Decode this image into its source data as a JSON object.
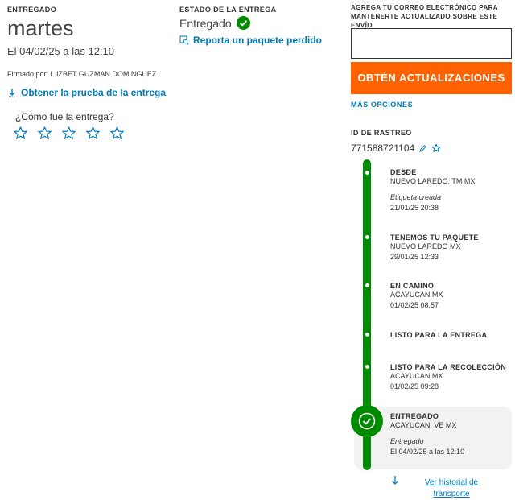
{
  "delivery": {
    "label": "ENTREGADO",
    "day": "martes",
    "date_line": "El 04/02/25 a las 12:10",
    "signed_by": "Firmado por: L.IZBET GUZMAN DOMINGUEZ",
    "proof_link": "Obtener la prueba de la entrega",
    "rating_question": "¿Cómo fue la entrega?",
    "rating_stars": 5
  },
  "status": {
    "label": "ESTADO DE LA ENTREGA",
    "value": "Entregado",
    "report_link": "Reporta un paquete perdido"
  },
  "email_panel": {
    "label": "AGREGA TU CORREO ELECTRÓNICO PARA MANTENERTE ACTUALIZADO SOBRE ESTE ENVÍO",
    "input_value": "",
    "button_label": "OBTÉN ACTUALIZACIONES",
    "more_options": "MÁS OPCIONES"
  },
  "tracking": {
    "label": "ID DE RASTREO",
    "number": "771588721104"
  },
  "timeline": [
    {
      "title": "DESDE",
      "location": "NUEVO LAREDO, TM MX",
      "note": "Etiqueta creada",
      "datetime": "21/01/25 20:38"
    },
    {
      "title": "TENEMOS TU PAQUETE",
      "location": "NUEVO LAREDO MX",
      "note": "",
      "datetime": "29/01/25 12:33"
    },
    {
      "title": "EN CAMINO",
      "location": "ACAYUCAN MX",
      "note": "",
      "datetime": "01/02/25 08:57"
    },
    {
      "title": "LISTO PARA LA ENTREGA",
      "location": "",
      "note": "",
      "datetime": ""
    },
    {
      "title": "LISTO PARA LA RECOLECCIÓN",
      "location": "ACAYUCAN MX",
      "note": "",
      "datetime": "01/02/25 09:28"
    },
    {
      "title": "ENTREGADO",
      "location": "ACAYUCAN, VE MX",
      "note": "Entregado",
      "datetime": "El 04/02/25 a las 12:10"
    }
  ],
  "history_link": "Ver historial de transporte",
  "colors": {
    "accent_orange": "#ff6200",
    "link_blue": "#007ab7",
    "success_green": "#008a00"
  }
}
